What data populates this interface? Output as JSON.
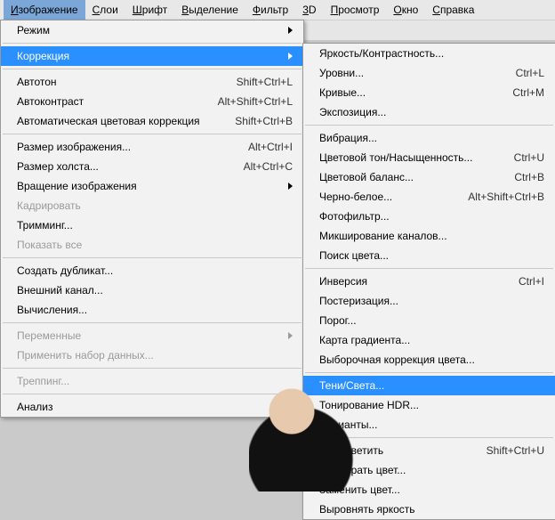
{
  "menubar": {
    "items": [
      {
        "label": "Изображение",
        "under": 0
      },
      {
        "label": "Слои",
        "under": 0
      },
      {
        "label": "Шрифт",
        "under": 0
      },
      {
        "label": "Выделение",
        "under": 0
      },
      {
        "label": "Фильтр",
        "under": 0
      },
      {
        "label": "3D",
        "under": 0
      },
      {
        "label": "Просмотр",
        "under": 0
      },
      {
        "label": "Окно",
        "under": 0
      },
      {
        "label": "Справка",
        "under": 0
      }
    ]
  },
  "toolstrip": {
    "percent": "%"
  },
  "left_menu": [
    {
      "type": "item",
      "label": "Режим",
      "sub": true
    },
    {
      "type": "sep"
    },
    {
      "type": "item",
      "label": "Коррекция",
      "sub": true,
      "hover": true
    },
    {
      "type": "sep"
    },
    {
      "type": "item",
      "label": "Автотон",
      "shortcut": "Shift+Ctrl+L"
    },
    {
      "type": "item",
      "label": "Автоконтраст",
      "shortcut": "Alt+Shift+Ctrl+L"
    },
    {
      "type": "item",
      "label": "Автоматическая цветовая коррекция",
      "shortcut": "Shift+Ctrl+B"
    },
    {
      "type": "sep"
    },
    {
      "type": "item",
      "label": "Размер изображения...",
      "shortcut": "Alt+Ctrl+I"
    },
    {
      "type": "item",
      "label": "Размер холста...",
      "shortcut": "Alt+Ctrl+C"
    },
    {
      "type": "item",
      "label": "Вращение изображения",
      "sub": true
    },
    {
      "type": "item",
      "label": "Кадрировать",
      "disabled": true
    },
    {
      "type": "item",
      "label": "Тримминг..."
    },
    {
      "type": "item",
      "label": "Показать все",
      "disabled": true
    },
    {
      "type": "sep"
    },
    {
      "type": "item",
      "label": "Создать дубликат..."
    },
    {
      "type": "item",
      "label": "Внешний канал..."
    },
    {
      "type": "item",
      "label": "Вычисления..."
    },
    {
      "type": "sep"
    },
    {
      "type": "item",
      "label": "Переменные",
      "sub": true,
      "disabled": true
    },
    {
      "type": "item",
      "label": "Применить набор данных...",
      "disabled": true
    },
    {
      "type": "sep"
    },
    {
      "type": "item",
      "label": "Треппинг...",
      "disabled": true
    },
    {
      "type": "sep"
    },
    {
      "type": "item",
      "label": "Анализ",
      "sub": true
    }
  ],
  "right_menu": [
    {
      "type": "item",
      "label": "Яркость/Контрастность..."
    },
    {
      "type": "item",
      "label": "Уровни...",
      "shortcut": "Ctrl+L"
    },
    {
      "type": "item",
      "label": "Кривые...",
      "shortcut": "Ctrl+M"
    },
    {
      "type": "item",
      "label": "Экспозиция..."
    },
    {
      "type": "sep"
    },
    {
      "type": "item",
      "label": "Вибрация..."
    },
    {
      "type": "item",
      "label": "Цветовой тон/Насыщенность...",
      "shortcut": "Ctrl+U"
    },
    {
      "type": "item",
      "label": "Цветовой баланс...",
      "shortcut": "Ctrl+B"
    },
    {
      "type": "item",
      "label": "Черно-белое...",
      "shortcut": "Alt+Shift+Ctrl+B"
    },
    {
      "type": "item",
      "label": "Фотофильтр..."
    },
    {
      "type": "item",
      "label": "Микширование каналов..."
    },
    {
      "type": "item",
      "label": "Поиск цвета..."
    },
    {
      "type": "sep"
    },
    {
      "type": "item",
      "label": "Инверсия",
      "shortcut": "Ctrl+I"
    },
    {
      "type": "item",
      "label": "Постеризация..."
    },
    {
      "type": "item",
      "label": "Порог..."
    },
    {
      "type": "item",
      "label": "Карта градиента..."
    },
    {
      "type": "item",
      "label": "Выборочная коррекция цвета..."
    },
    {
      "type": "sep"
    },
    {
      "type": "item",
      "label": "Тени/Света...",
      "hover": true
    },
    {
      "type": "item",
      "label": "Тонирование HDR..."
    },
    {
      "type": "item",
      "label": "Варианты..."
    },
    {
      "type": "sep"
    },
    {
      "type": "item",
      "label": "Обесцветить",
      "shortcut": "Shift+Ctrl+U"
    },
    {
      "type": "item",
      "label": "Подобрать цвет..."
    },
    {
      "type": "item",
      "label": "Заменить цвет..."
    },
    {
      "type": "item",
      "label": "Выровнять яркость"
    }
  ]
}
